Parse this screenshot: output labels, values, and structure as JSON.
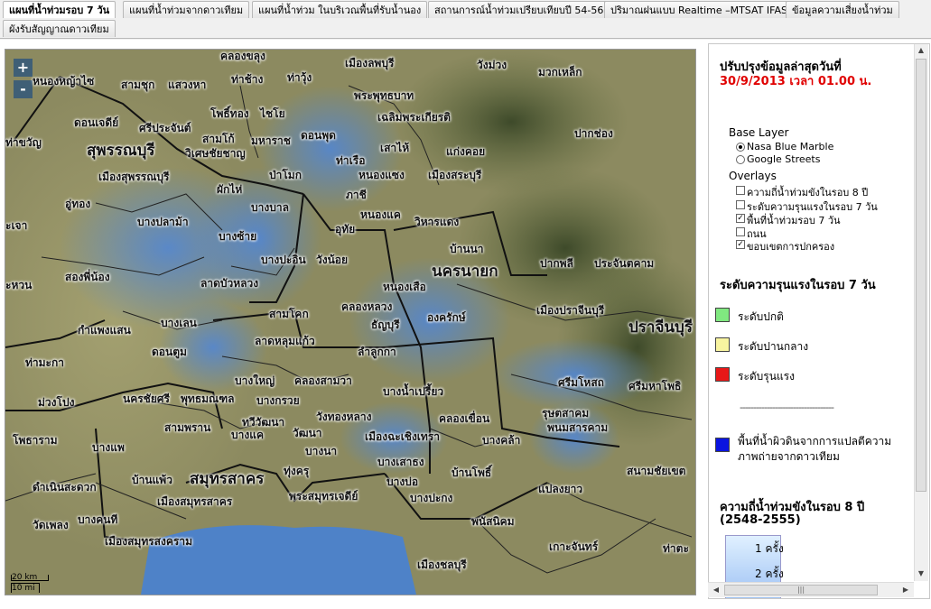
{
  "tabs": [
    {
      "label": "แผนที่น้ำท่วมรอบ 7 วัน",
      "active": true
    },
    {
      "label": "แผนที่น้ำท่วมจากดาวเทียม",
      "active": false
    },
    {
      "label": "แผนที่น้ำท่วม ในบริเวณพื้นที่รับน้ำนอง",
      "active": false
    },
    {
      "label": "สถานการณ์น้ำท่วมเปรียบเทียบปี 54-56",
      "active": false
    },
    {
      "label": "ปริมาณฝนแบบ Realtime –MTSAT IFAS",
      "active": false
    },
    {
      "label": "ข้อมูลความเสี่ยงน้ำท่วม",
      "active": false
    },
    {
      "label": "ผังรับสัญญาณดาวเทียม",
      "active": false
    }
  ],
  "map": {
    "zoom_in": "+",
    "zoom_out": "-",
    "scale_km": "20 km",
    "scale_mi": "10 mi",
    "place_labels": {
      "l01": "คลองขลุง",
      "l02": "เมืองลพบุรี",
      "l03": "วังม่วง",
      "l04": "หนองหญ้าไซ",
      "l05": "สามชุก",
      "l06": "แสวงหา",
      "l07": "ท่าช้าง",
      "l08": "ท่าวุ้ง",
      "l09": "พระพุทธบาท",
      "l10": "มวกเหล็ก",
      "l11": "ดอนเจดีย์",
      "l12": "ศรีประจันต์",
      "l13": "โพธิ์ทอง",
      "l14": "ไชโย",
      "l15": "เฉลิมพระเกียรติ",
      "l16": "ปากช่อง",
      "l17": "ท่าขวัญ",
      "l18": "สุพรรณบุรี",
      "l19": "สามโก้",
      "l20": "มหาราช",
      "l21": "ดอนพุด",
      "l22": "เสาไห้",
      "l23": "แก่งคอย",
      "l24": "วิเศษชัยชาญ",
      "l25": "ท่าเรือ",
      "l26": "หนองแซง",
      "l27": "เมืองสระบุรี",
      "l28": "เมืองสุพรรณบุรี",
      "l29": "ป่าโมก",
      "l30": "ผักไห่",
      "l31": "ภาชี",
      "l32": "อู่ทอง",
      "l33": "บางบาล",
      "l34": "หนองแค",
      "l35": "วิหารแดง",
      "l36": "ะเจา",
      "l37": "บางปลาม้า",
      "l38": "อุทัย",
      "l39": "บ้านนา",
      "l40": "บางซ้าย",
      "l41": "นครนายก",
      "l42": "ปากพลี",
      "l43": "ประจันตคาม",
      "l44": "บางปะอิน",
      "l45": "วังน้อย",
      "l46": "สองพี่น้อง",
      "l47": "ลาดบัวหลวง",
      "l48": "หนองเสือ",
      "l49": "ะหวน",
      "l50": "สามโคก",
      "l51": "คลองหลวง",
      "l52": "ธัญบุรี",
      "l53": "องครักษ์",
      "l54": "เมืองปราจีนบุรี",
      "l55": "ปราจีนบุรี",
      "l56": "กำแพงแสน",
      "l57": "บางเลน",
      "l58": "ลาดหลุมแก้ว",
      "l59": "ลำลูกกา",
      "l60": "ดอนตูม",
      "l61": "ท่ามะกา",
      "l62": "บางใหญ่",
      "l63": "คลองสามวา",
      "l64": "ศรีมโหสถ",
      "l65": "ศรีมหาโพธิ",
      "l66": "บางน้ำเปรี้ยว",
      "l67": "นครชัยศรี",
      "l68": "พุทธมณฑล",
      "l69": "บางกรวย",
      "l70": "ม่วงโปง",
      "l71": "สามพราน",
      "l72": "ทวีวัฒนา",
      "l73": "วังทองหลาง",
      "l74": "คลองเขื่อน",
      "l75": "รุษตสาคม",
      "l76": "พนมสารคาม",
      "l77": "โพธาราม",
      "l78": "บางแค",
      "l79": "วัฒนา",
      "l80": "เมืองฉะเชิงเทรา",
      "l81": "บางคล้า",
      "l82": "บางแพ",
      "l83": "บางนา",
      "l84": "บางเสาธง",
      "l85": "บ้านโพธิ์",
      "l86": "สนามชัยเขต",
      "l87": "ดำเนินสะดวก",
      "l88": "บ้านแพ้ว",
      "l89": "สมุทรสาคร",
      "l90": "ทุ่งครุ",
      "l91": "เมืองสมุทรสาคร",
      "l92": "พระสมุทรเจดีย์",
      "l93": "บางบ่อ",
      "l94": "บางปะกง",
      "l95": "แปลงยาว",
      "l96": "วัดเพลง",
      "l97": "บางคนที",
      "l98": "พนัสนิคม",
      "l99": "เมืองสมุทรสงคราม",
      "l100": "เกาะจันทร์",
      "l101": "ท่าตะ",
      "l102": "เมืองชลบุรี"
    }
  },
  "panel": {
    "update_title": "ปรับปรุงข้อมูลล่าสุดวันที่",
    "update_datetime": "30/9/2013 เวลา 01.00 น.",
    "base_layer_title": "Base Layer",
    "base_layers": [
      "Nasa Blue Marble",
      "Google Streets"
    ],
    "overlays_title": "Overlays",
    "overlays": [
      {
        "label": "ความถี่น้ำท่วมขังในรอบ 8 ปี",
        "checked": false
      },
      {
        "label": "ระดับความรุนแรงในรอบ 7 วัน",
        "checked": false
      },
      {
        "label": "พื้นที่น้ำท่วมรอบ 7 วัน",
        "checked": true
      },
      {
        "label": "ถนน",
        "checked": false
      },
      {
        "label": "ขอบเขตการปกครอง",
        "checked": true
      }
    ],
    "severity_title": "ระดับความรุนแรงในรอบ 7 วัน",
    "severity_legend": [
      {
        "label": "ระดับปกติ",
        "color": "#80e880"
      },
      {
        "label": "ระดับปานกลาง",
        "color": "#f8f4a0"
      },
      {
        "label": "ระดับรุนแรง",
        "color": "#e81818"
      }
    ],
    "separator": "-----------------------------------",
    "water_label_1": "พื้นที่น้ำผิวดินจากการแปลตีความ",
    "water_label_2": "ภาพถ่ายจากดาวเทียม",
    "water_color": "#0a14e0",
    "freq_title": "ความถี่น้ำท่วมขังในรอบ 8 ปี",
    "freq_years": "(2548-2555)",
    "freq_items": [
      "1 ครั้ง",
      "2 ครั้ง"
    ]
  }
}
